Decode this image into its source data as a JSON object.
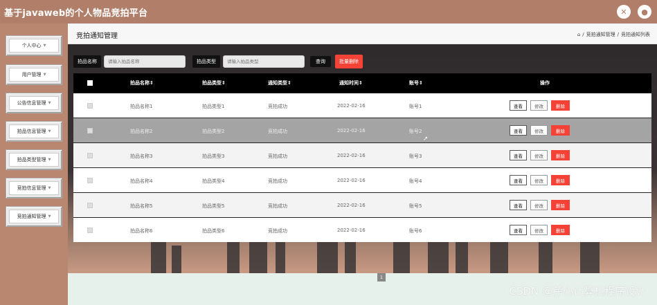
{
  "app": {
    "title": "基于javaweb的个人物品竞拍平台"
  },
  "sidebar": {
    "items": [
      {
        "label": "个人中心"
      },
      {
        "label": "用户管理"
      },
      {
        "label": "公告信息管理"
      },
      {
        "label": "拍品信息管理"
      },
      {
        "label": "拍品类型管理"
      },
      {
        "label": "竞拍信息管理"
      },
      {
        "label": "竞拍通知管理"
      }
    ]
  },
  "page": {
    "title": "竞拍通知管理",
    "breadcrumb": [
      "竞拍通知管理",
      "竞拍通知列表"
    ]
  },
  "search": {
    "name_label": "拍品名称",
    "name_placeholder": "请输入拍品名称",
    "type_label": "拍品类型",
    "type_placeholder": "请输入拍品类型",
    "query_label": "查询",
    "batch_delete_label": "批量删除"
  },
  "table": {
    "columns": [
      "拍品名称",
      "拍品类型",
      "通知类型",
      "通知时间",
      "账号",
      "操作"
    ],
    "rows": [
      {
        "name": "拍品名称1",
        "type": "拍品类型1",
        "notice_type": "竞拍成功",
        "time": "2022-02-16",
        "account": "账号1"
      },
      {
        "name": "拍品名称2",
        "type": "拍品类型2",
        "notice_type": "竞拍成功",
        "time": "2022-02-16",
        "account": "账号2"
      },
      {
        "name": "拍品名称3",
        "type": "拍品类型3",
        "notice_type": "竞拍成功",
        "time": "2022-02-16",
        "account": "账号3"
      },
      {
        "name": "拍品名称4",
        "type": "拍品类型4",
        "notice_type": "竞拍成功",
        "time": "2022-02-16",
        "account": "账号4"
      },
      {
        "name": "拍品名称5",
        "type": "拍品类型5",
        "notice_type": "竞拍成功",
        "time": "2022-02-16",
        "account": "账号5"
      },
      {
        "name": "拍品名称6",
        "type": "拍品类型6",
        "notice_type": "竞拍成功",
        "time": "2022-02-16",
        "account": "账号6"
      }
    ],
    "actions": {
      "view": "查看",
      "edit": "修改",
      "delete": "删除"
    }
  },
  "pagination": {
    "current": "1"
  },
  "watermark": "CSDN @芹心计算机程序设计",
  "colors": {
    "accent": "#f44336",
    "topbar": "#b17f69",
    "header": "#000000"
  },
  "icons": {
    "top_left_icon": "close-icon",
    "top_right_icon": "user-icon",
    "home": "home-icon"
  }
}
